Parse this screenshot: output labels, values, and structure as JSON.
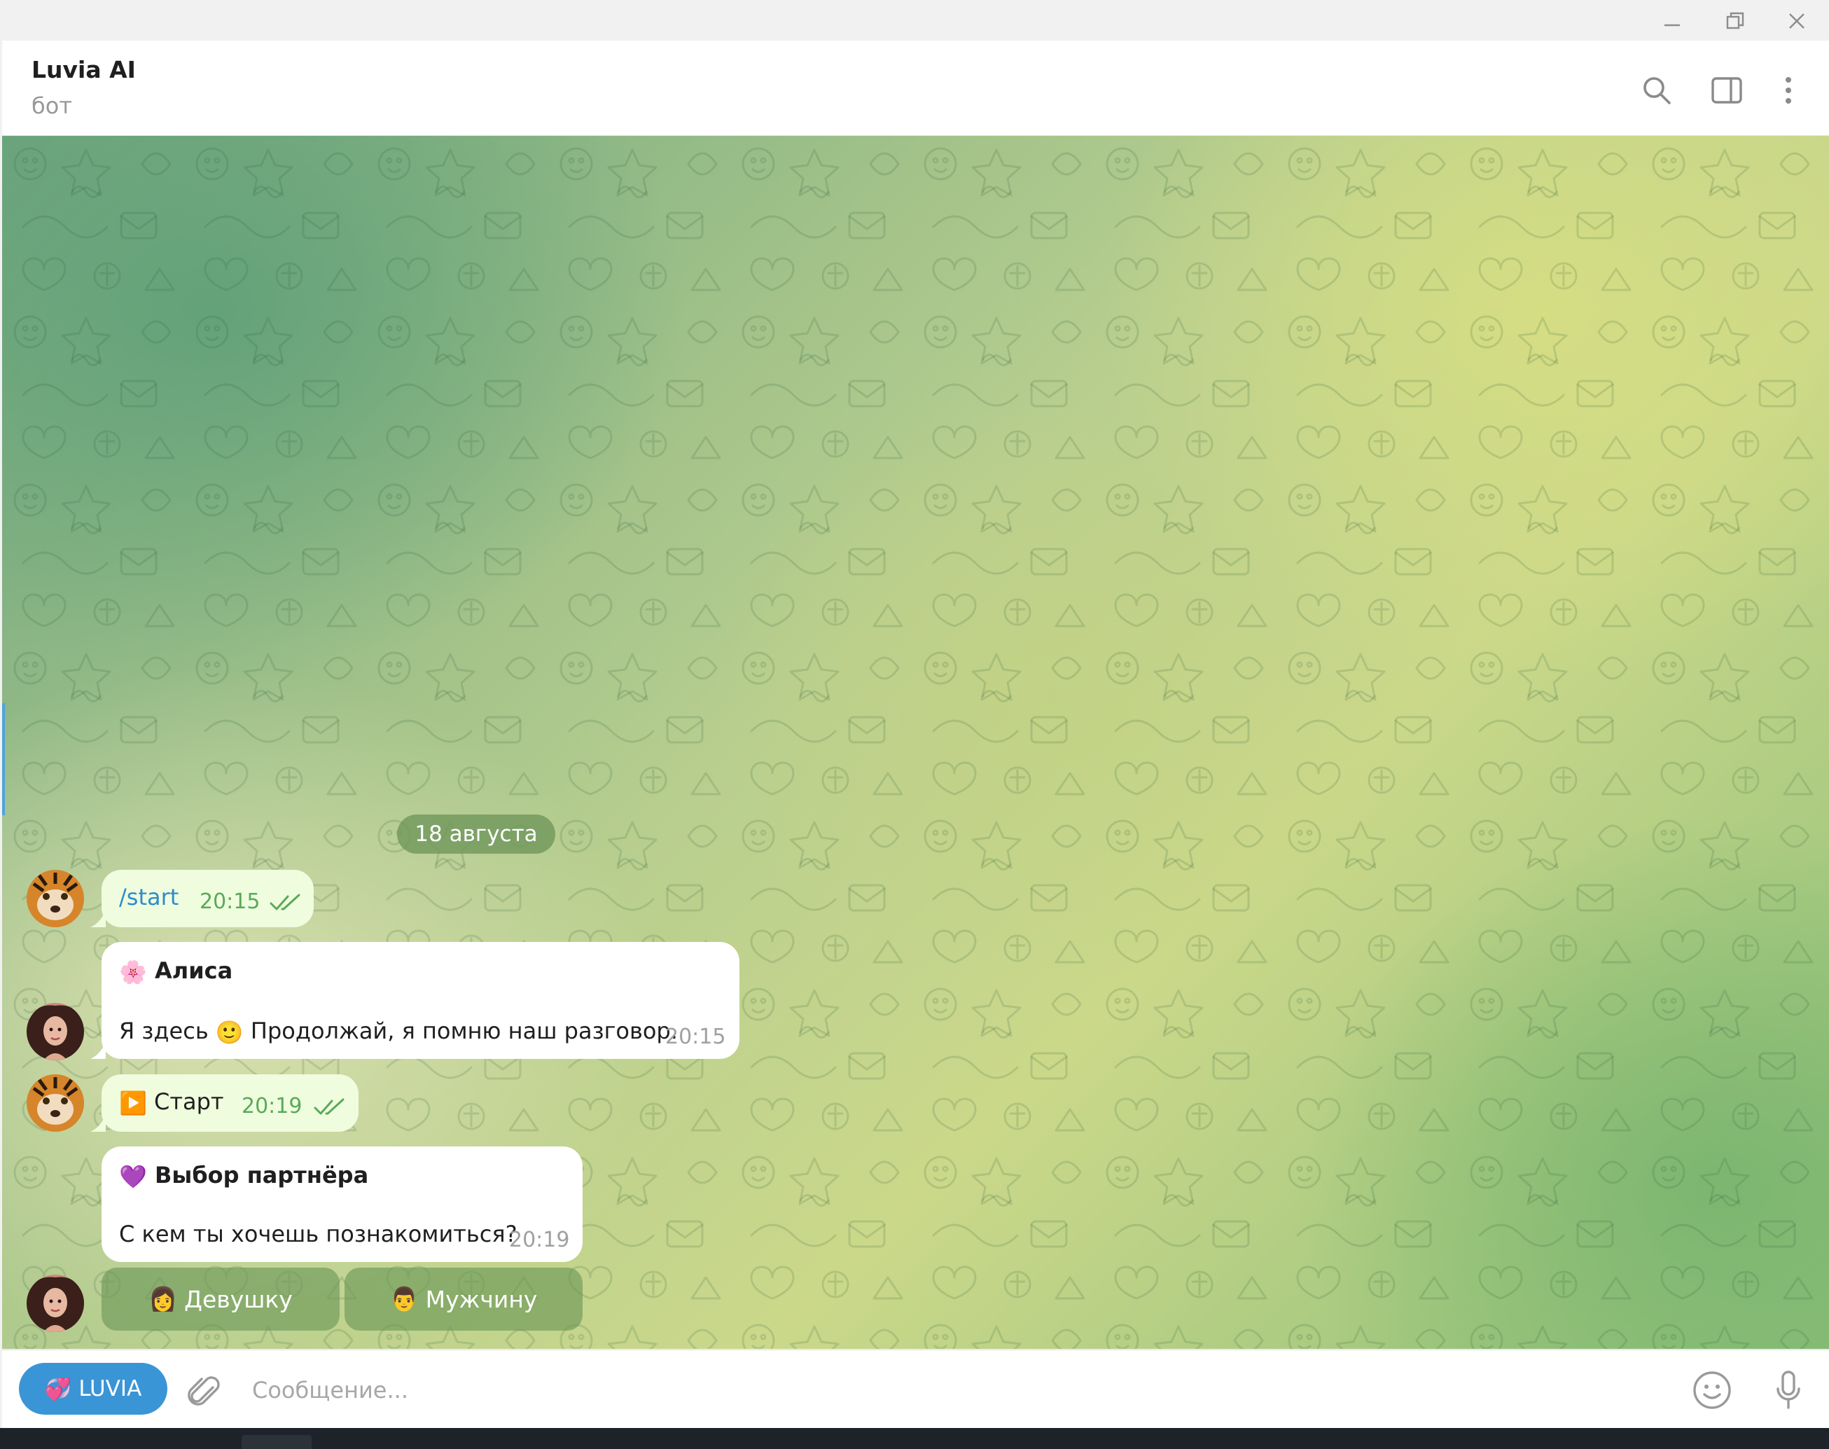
{
  "window": {
    "minimize_glyph": "—",
    "restore_glyph": "❐",
    "close_glyph": "✕"
  },
  "header": {
    "title": "Luvia AI",
    "subtitle": "бот",
    "icons": [
      "search-icon",
      "sidebar-toggle-icon",
      "more-vertical-icon"
    ]
  },
  "chat": {
    "date_separator": "18 августа",
    "messages": [
      {
        "direction": "outgoing",
        "text": "/start",
        "time": "20:15",
        "status": "read"
      },
      {
        "direction": "incoming",
        "emoji": "🌸",
        "title": "Алиса",
        "text_before_emoji": "Я здесь",
        "inline_emoji": "🙂",
        "text_after_emoji": "Продолжай, я помню наш разговор.",
        "time": "20:15"
      },
      {
        "direction": "outgoing",
        "emoji": "▶️",
        "text": "Старт",
        "time": "20:19",
        "status": "read"
      },
      {
        "direction": "incoming",
        "emoji": "💜",
        "title": "Выбор партнёра",
        "text": "С кем ты хочешь познакомиться?",
        "time": "20:19"
      }
    ],
    "keyboard": [
      {
        "emoji": "👩",
        "label": "Девушку"
      },
      {
        "emoji": "👨",
        "label": "Мужчину"
      }
    ]
  },
  "composer": {
    "menu_button_emoji": "💞",
    "menu_button_label": "LUVIA",
    "placeholder": "Сообщение...",
    "icons": [
      "attach-icon",
      "emoji-icon",
      "microphone-icon"
    ]
  },
  "colors": {
    "accent": "#3a95d6",
    "outgoing_bubble": "#effdde",
    "incoming_bubble": "#ffffff",
    "read_check": "#5aa95a"
  }
}
